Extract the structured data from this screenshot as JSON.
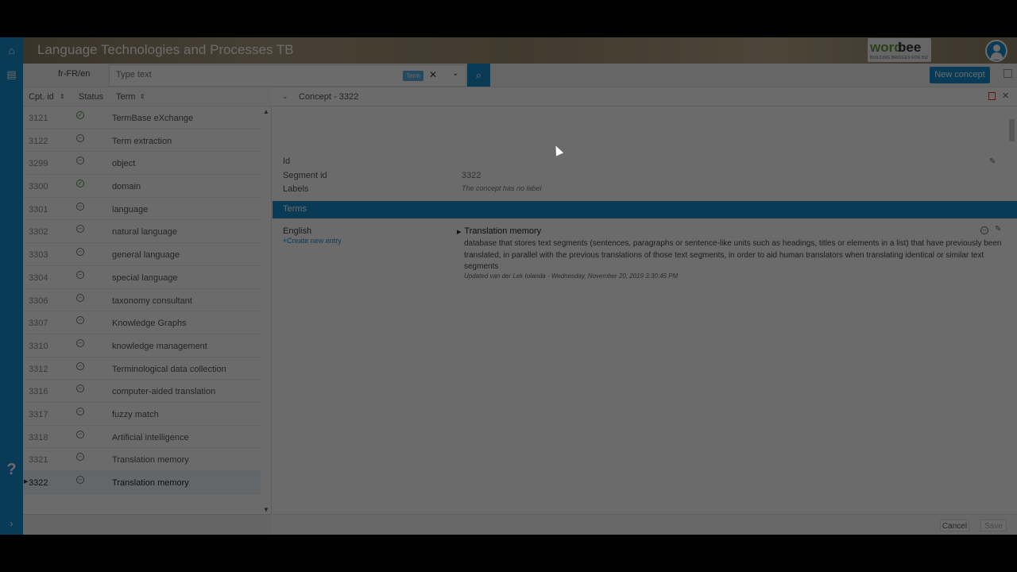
{
  "header": {
    "title": "Language Technologies and Processes TB",
    "logo_word_a": "word",
    "logo_word_b": "bee",
    "logo_tagline": "BUILDING BRIDGES FOR BIZ"
  },
  "toolbar": {
    "language_pair": "fr-FR/en",
    "search_placeholder": "Type text",
    "search_badge": "Term",
    "new_concept_label": "New concept"
  },
  "list": {
    "columns": [
      "Cpt. id",
      "Status",
      "Term"
    ],
    "rows": [
      {
        "id": "3121",
        "status": "approved",
        "term": "TermBase eXchange"
      },
      {
        "id": "3122",
        "status": "pending",
        "term": "Term extraction"
      },
      {
        "id": "3299",
        "status": "pending",
        "term": "object"
      },
      {
        "id": "3300",
        "status": "approved",
        "term": "domain"
      },
      {
        "id": "3301",
        "status": "pending",
        "term": "language"
      },
      {
        "id": "3302",
        "status": "pending",
        "term": "natural language"
      },
      {
        "id": "3303",
        "status": "pending",
        "term": "general language"
      },
      {
        "id": "3304",
        "status": "pending",
        "term": "special language"
      },
      {
        "id": "3306",
        "status": "pending",
        "term": "taxonomy consultant"
      },
      {
        "id": "3307",
        "status": "pending",
        "term": "Knowledge Graphs"
      },
      {
        "id": "3310",
        "status": "pending",
        "term": "knowledge management"
      },
      {
        "id": "3312",
        "status": "pending",
        "term": "Terminological data collection"
      },
      {
        "id": "3316",
        "status": "pending",
        "term": "computer-aided translation"
      },
      {
        "id": "3317",
        "status": "pending",
        "term": "fuzzy match"
      },
      {
        "id": "3318",
        "status": "pending",
        "term": "Artificial intelligence"
      },
      {
        "id": "3321",
        "status": "pending",
        "term": "Translation memory"
      },
      {
        "id": "3322",
        "status": "pending",
        "term": "Translation memory",
        "selected": true
      }
    ]
  },
  "detail": {
    "title": "Concept - 3322",
    "fields": [
      {
        "label": "Id",
        "value": ""
      },
      {
        "label": "Segment id",
        "value": "3322"
      },
      {
        "label": "Labels",
        "value": "The concept has no label"
      }
    ],
    "terms_section": "Terms",
    "language": "English",
    "add_entry": "Create new entry",
    "term": "Translation memory",
    "definition": "database that stores text segments (sentences, paragraphs or sentence-like units such as headings, titles or elements in a list) that have previously been translated, in parallel with the previous translations of those text segments, in order to aid human translators when translating identical or similar text segments",
    "updated": "Updated van der Lek Iolanda - Wednesday, November 20, 2019 3:30:45 PM"
  },
  "footer": {
    "cancel_label": "Cancel",
    "save_label": "Save"
  },
  "colors": {
    "accent": "#1a8ccd",
    "approved": "#4a9a3a"
  },
  "icons": {
    "rail": [
      "home-icon",
      "book-icon",
      "help-icon",
      "expand-icon"
    ],
    "approved": "check-circle-icon",
    "pending": "minus-circle-icon"
  }
}
